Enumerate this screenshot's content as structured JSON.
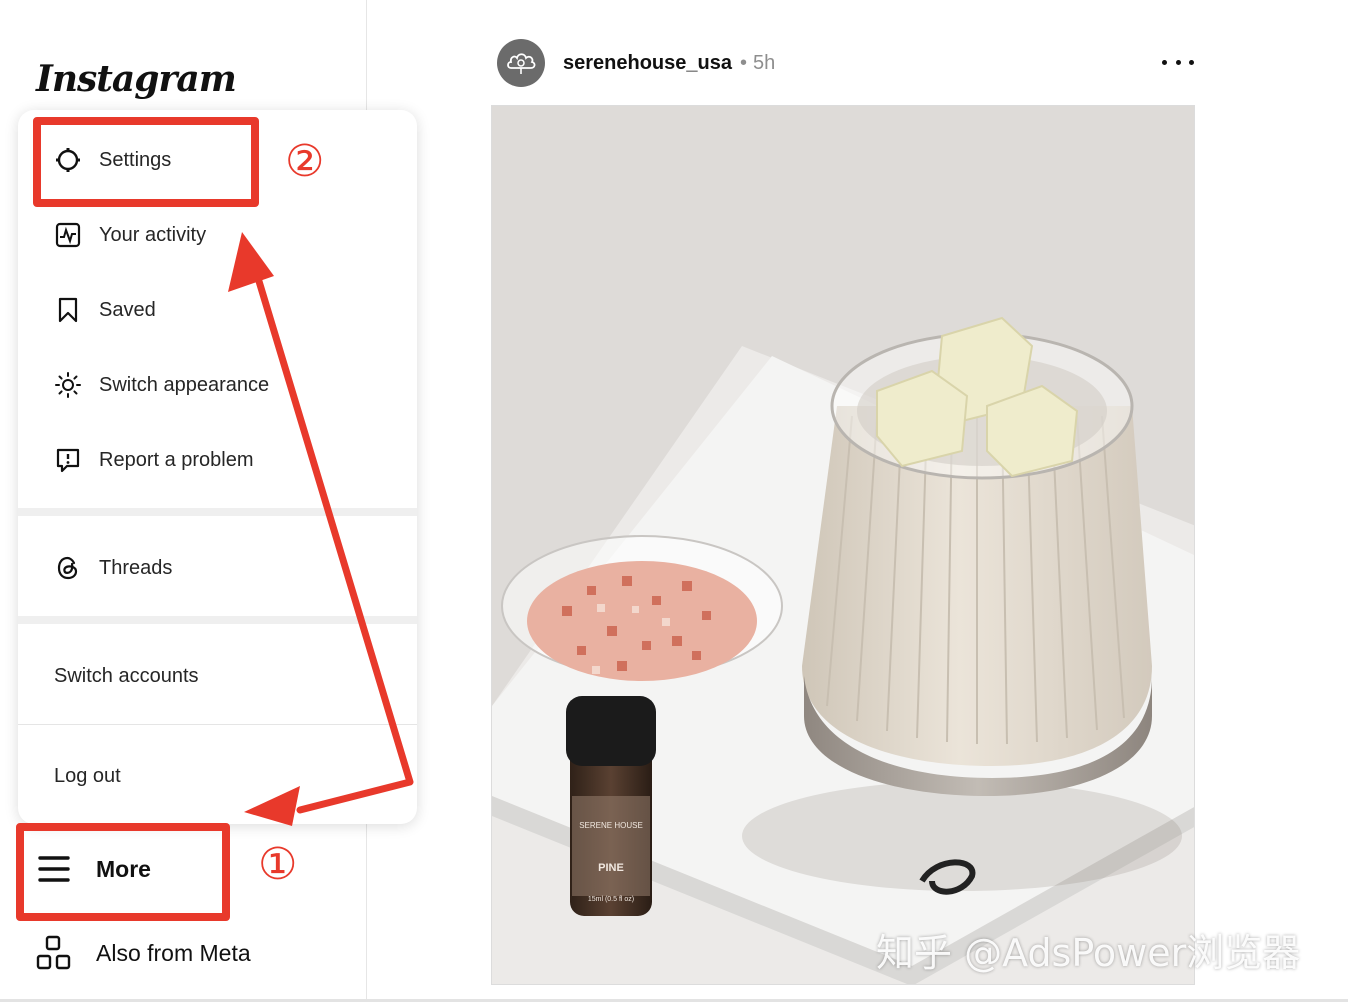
{
  "sidebar": {
    "logo": "Instagram",
    "more_label": "More",
    "meta_label": "Also from Meta"
  },
  "menu": {
    "items": [
      {
        "label": "Settings",
        "icon": "settings-icon"
      },
      {
        "label": "Your activity",
        "icon": "activity-icon"
      },
      {
        "label": "Saved",
        "icon": "bookmark-icon"
      },
      {
        "label": "Switch appearance",
        "icon": "sun-icon"
      },
      {
        "label": "Report a problem",
        "icon": "report-icon"
      }
    ],
    "threads_label": "Threads",
    "switch_accounts_label": "Switch accounts",
    "logout_label": "Log out"
  },
  "post": {
    "username": "serenehouse_usa",
    "separator": "•",
    "time": "5h",
    "bottle_brand": "SERENE HOUSE",
    "bottle_scent": "PINE",
    "bottle_volume": "15ml (0.5 fl oz)"
  },
  "annotations": {
    "step1": "①",
    "step2": "②",
    "color": "#e8392b"
  },
  "watermark": "知乎 @AdsPower浏览器"
}
